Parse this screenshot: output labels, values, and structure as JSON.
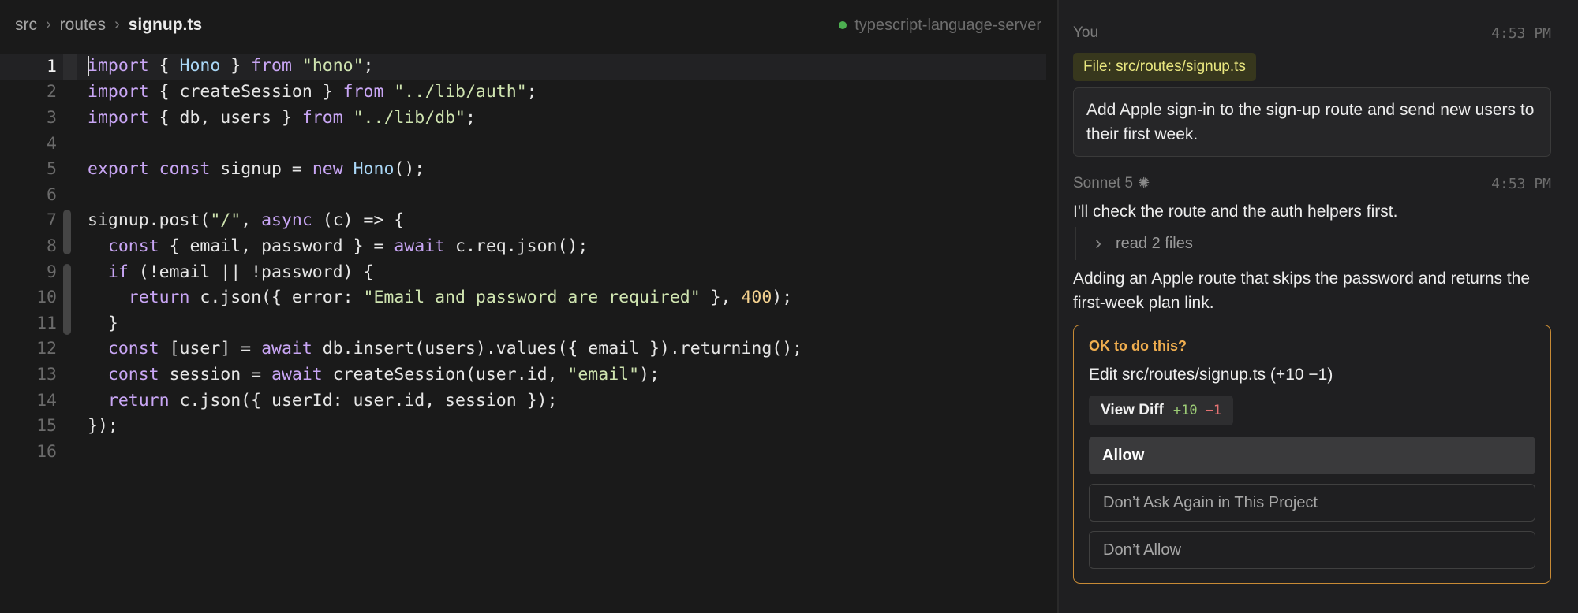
{
  "breadcrumb": [
    "src",
    "routes",
    "signup.ts"
  ],
  "status": {
    "lsp": "typescript-language-server",
    "lsp_color": "#4caf50"
  },
  "editor": {
    "active_line": 1,
    "line_numbers": [
      "1",
      "2",
      "3",
      "4",
      "5",
      "6",
      "7",
      "8",
      "9",
      "10",
      "11",
      "12",
      "13",
      "14",
      "15",
      "16"
    ],
    "lines": [
      "import { Hono } from \"hono\";",
      "import { createSession } from \"../lib/auth\";",
      "import { db, users } from \"../lib/db\";",
      "",
      "export const signup = new Hono();",
      "",
      "signup.post(\"/\", async (c) => {",
      "  const { email, password } = await c.req.json();",
      "  if (!email || !password) {",
      "    return c.json({ error: \"Email and password are required\" }, 400);",
      "  }",
      "  const [user] = await db.insert(users).values({ email }).returning();",
      "  const session = await createSession(user.id, \"email\");",
      "  return c.json({ userId: user.id, session });",
      "});",
      ""
    ]
  },
  "chat": {
    "user": {
      "name": "You",
      "time": "4:53 PM",
      "file_chip": "File: src/routes/signup.ts",
      "message": "Add Apple sign-in to the sign-up route and send new users to their first week."
    },
    "assistant": {
      "name": "Sonnet 5",
      "time": "4:53 PM",
      "text1": "I'll check the route and the auth helpers first.",
      "tool": "read 2 files",
      "text2": "Adding an Apple route that skips the password and returns the first-week plan link."
    },
    "approval": {
      "heading": "OK to do this?",
      "action": "Edit src/routes/signup.ts (+10 −1)",
      "view_diff": "View Diff",
      "added": "+10",
      "removed": "−1",
      "allow": "Allow",
      "dont_ask": "Don’t Ask Again in This Project",
      "deny": "Don’t Allow",
      "accent": "#c78a35"
    }
  }
}
